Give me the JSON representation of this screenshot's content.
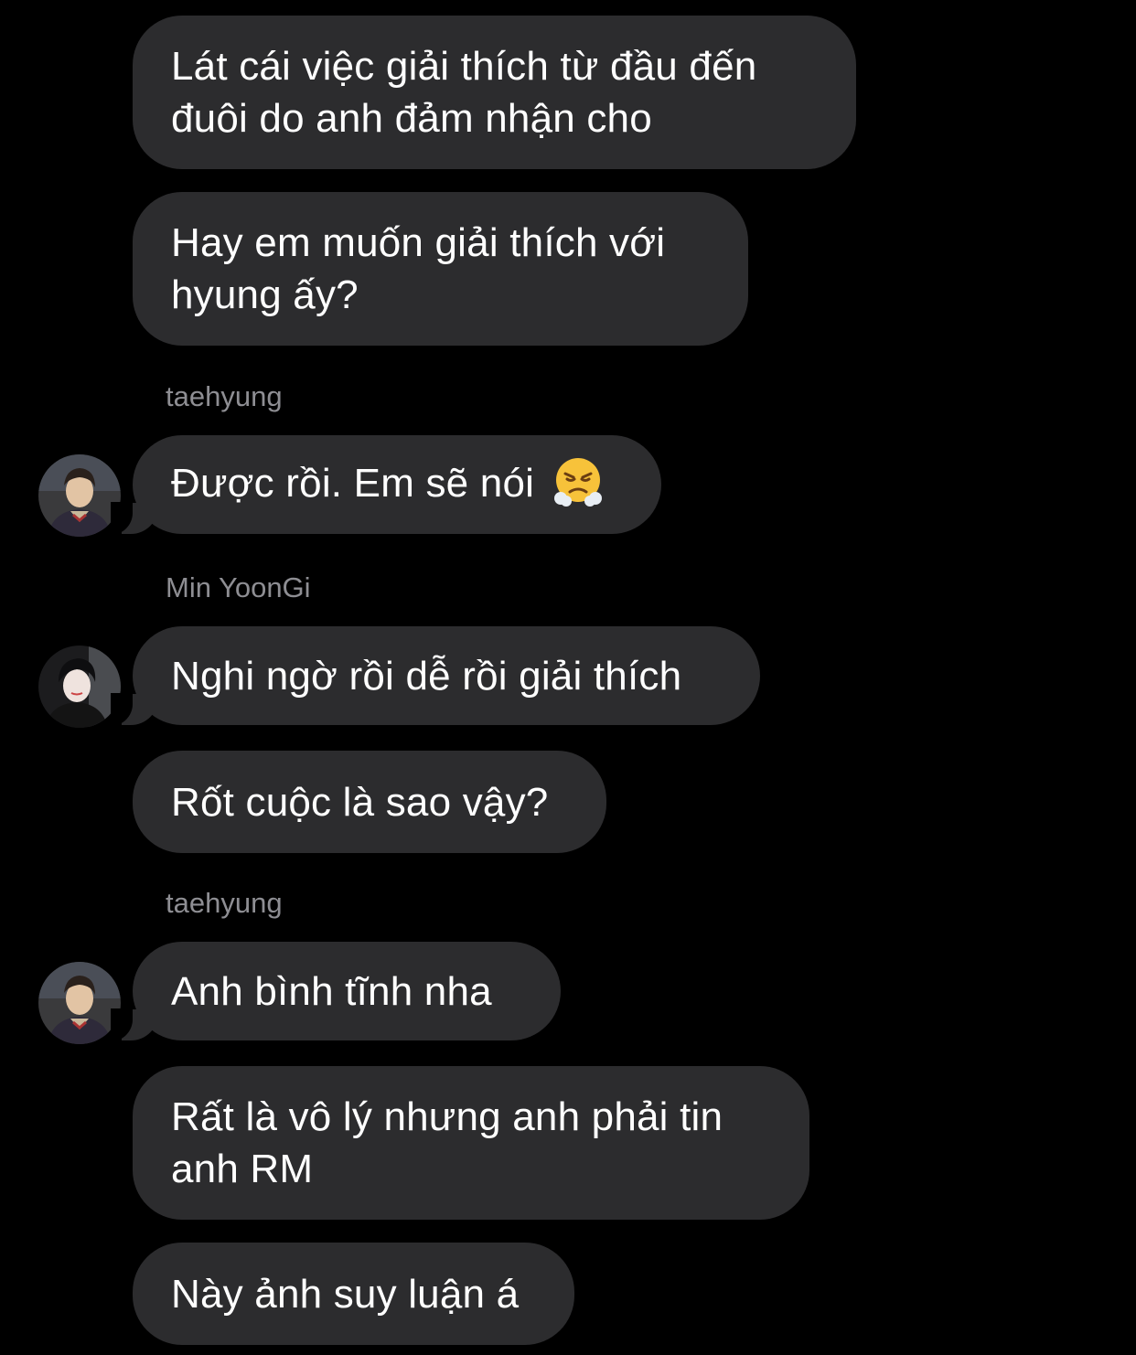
{
  "conversation": {
    "messages": [
      {
        "text": "Lát cái việc giải thích từ đầu đến đuôi do anh đảm nhận cho"
      },
      {
        "text": "Hay em muốn giải thích với hyung ấy?"
      },
      {
        "sender": "taehyung",
        "text": "Được rồi. Em sẽ nói",
        "emoji": "face-with-steam-from-nose"
      },
      {
        "sender": "Min YoonGi",
        "text": "Nghi ngờ rồi dễ rồi giải thích"
      },
      {
        "text": "Rốt cuộc là sao vậy?"
      },
      {
        "sender": "taehyung",
        "text": "Anh bình tĩnh nha"
      },
      {
        "text": "Rất là vô lý nhưng anh phải tin anh RM"
      },
      {
        "text": "Này ảnh suy luận á"
      }
    ]
  },
  "colors": {
    "background": "#000000",
    "bubble": "#2c2c2e",
    "text": "#ffffff",
    "sender_label": "#8e8e93"
  },
  "icons": {
    "avatar_taehyung": "avatar-photo",
    "avatar_yoongi": "avatar-photo"
  }
}
